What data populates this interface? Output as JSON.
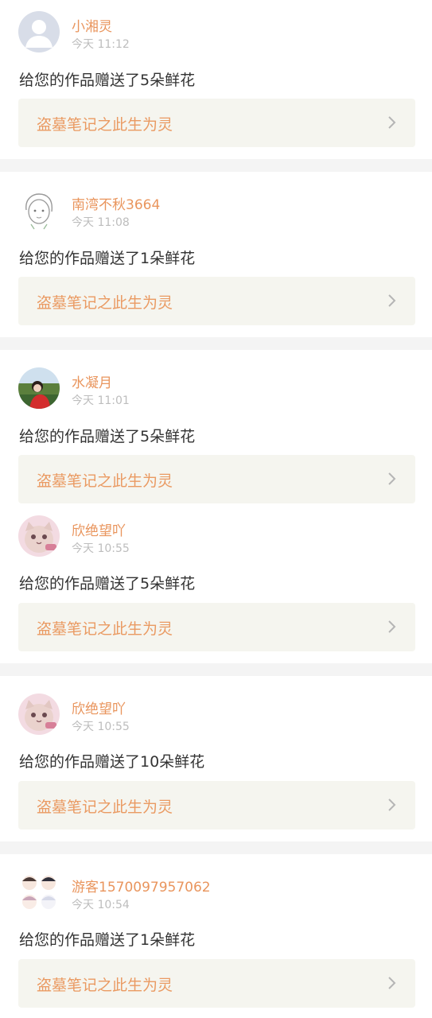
{
  "entries": [
    {
      "user_name": "小湘灵",
      "time": "今天 11:12",
      "message": "给您的作品赠送了5朵鲜花",
      "work_title": "盗墓笔记之此生为灵",
      "avatar": "default-avatar-icon"
    },
    {
      "user_name": "南湾不秋3664",
      "time": "今天 11:08",
      "message": "给您的作品赠送了1朵鲜花",
      "work_title": "盗墓笔记之此生为灵",
      "avatar": "sketch-avatar"
    },
    {
      "user_name": "水凝月",
      "time": "今天 11:01",
      "message": "给您的作品赠送了5朵鲜花",
      "work_title": "盗墓笔记之此生为灵",
      "avatar": "photo-avatar"
    },
    {
      "user_name": "欣绝望吖",
      "time": "今天 10:55",
      "message": "给您的作品赠送了5朵鲜花",
      "work_title": "盗墓笔记之此生为灵",
      "avatar": "cat-avatar"
    },
    {
      "user_name": "欣绝望吖",
      "time": "今天 10:55",
      "message": "给您的作品赠送了10朵鲜花",
      "work_title": "盗墓笔记之此生为灵",
      "avatar": "cat-avatar"
    },
    {
      "user_name": "游客1570097957062",
      "time": "今天 10:54",
      "message": "给您的作品赠送了1朵鲜花",
      "work_title": "盗墓笔记之此生为灵",
      "avatar": "group-avatar"
    }
  ],
  "colors": {
    "name": "#e9955d",
    "work_title": "#ea9a62",
    "card_bg": "#f5f5ef",
    "divider": "#f4f4f4",
    "time": "#bdbdbd",
    "message": "#333333"
  }
}
